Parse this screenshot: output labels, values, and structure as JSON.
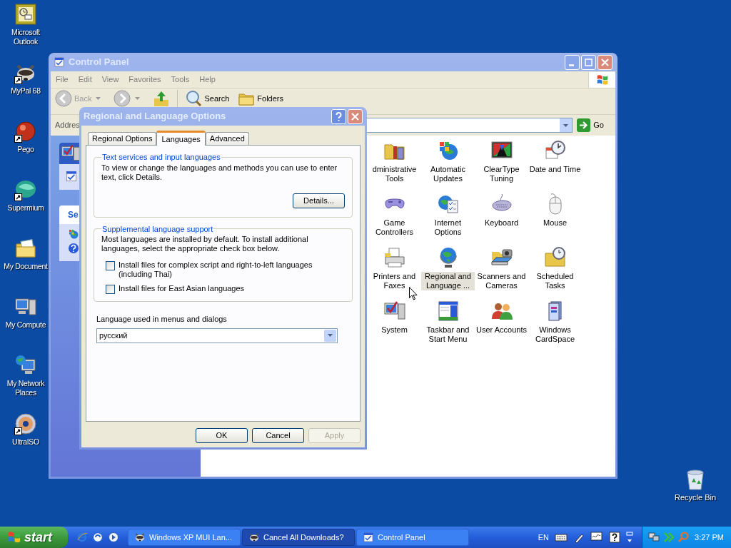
{
  "desktop": {
    "icons": [
      {
        "label": "Microsoft Outlook",
        "kind": "outlook",
        "shortcut": false
      },
      {
        "label": "MyPal 68",
        "kind": "raccoon",
        "shortcut": true
      },
      {
        "label": "Pego",
        "kind": "ball",
        "shortcut": true
      },
      {
        "label": "Supermium",
        "kind": "orb",
        "shortcut": true
      },
      {
        "label": "My Document",
        "kind": "documents",
        "shortcut": false
      },
      {
        "label": "My Compute",
        "kind": "computer",
        "shortcut": false
      },
      {
        "label": "My Network Places",
        "kind": "network",
        "shortcut": false
      },
      {
        "label": "UltraISO",
        "kind": "disc",
        "shortcut": true
      }
    ],
    "recycle_bin": {
      "label": "Recycle Bin"
    }
  },
  "control_panel": {
    "title": "Control Panel",
    "menu": [
      "File",
      "Edit",
      "View",
      "Favorites",
      "Tools",
      "Help"
    ],
    "toolbar": {
      "back": "Back",
      "search": "Search",
      "folders": "Folders"
    },
    "address": {
      "label": "Addres",
      "go": "Go"
    },
    "task_pane": {
      "section_title": "Se"
    },
    "items": [
      {
        "label": "dministrative Tools",
        "kind": "admin",
        "selected": false
      },
      {
        "label": "Automatic Updates",
        "kind": "updates",
        "selected": false
      },
      {
        "label": "ClearType Tuning",
        "kind": "cleartype",
        "selected": false
      },
      {
        "label": "Date and Time",
        "kind": "clock",
        "selected": false
      },
      {
        "label": "Game Controllers",
        "kind": "gamepad",
        "selected": false
      },
      {
        "label": "Internet Options",
        "kind": "internet",
        "selected": false
      },
      {
        "label": "Keyboard",
        "kind": "keyboard",
        "selected": false
      },
      {
        "label": "Mouse",
        "kind": "mouse",
        "selected": false
      },
      {
        "label": "Printers and Faxes",
        "kind": "printer",
        "selected": false
      },
      {
        "label": "Regional and Language ...",
        "kind": "globe",
        "selected": true
      },
      {
        "label": "Scanners and Cameras",
        "kind": "scanner",
        "selected": false
      },
      {
        "label": "Scheduled Tasks",
        "kind": "scheduled",
        "selected": false
      },
      {
        "label": "System",
        "kind": "system",
        "selected": false
      },
      {
        "label": "Taskbar and Start Menu",
        "kind": "taskbar",
        "selected": false
      },
      {
        "label": "User Accounts",
        "kind": "users",
        "selected": false
      },
      {
        "label": "Windows CardSpace",
        "kind": "cardspace",
        "selected": false
      }
    ]
  },
  "dialog": {
    "title": "Regional and Language Options",
    "tabs": [
      {
        "label": "Regional Options",
        "selected": false
      },
      {
        "label": "Languages",
        "selected": true
      },
      {
        "label": "Advanced",
        "selected": false
      }
    ],
    "text_services": {
      "legend": "Text services and input languages",
      "description": "To view or change the languages and methods you can use to enter text, click Details.",
      "button": "Details..."
    },
    "supplemental": {
      "legend": "Supplemental language support",
      "description": "Most languages are installed by default. To install additional languages, select the appropriate check box below.",
      "options": [
        {
          "label": "Install files for complex script and right-to-left languages (including Thai)",
          "checked": false
        },
        {
          "label": "Install files for East Asian languages",
          "checked": false
        }
      ]
    },
    "ui_language": {
      "label": "Language used in menus and dialogs",
      "value": "русский"
    },
    "buttons": [
      {
        "label": "OK",
        "disabled": false
      },
      {
        "label": "Cancel",
        "disabled": false
      },
      {
        "label": "Apply",
        "disabled": true
      }
    ]
  },
  "taskbar": {
    "start": "start",
    "quick_launch": [
      {
        "kind": "ie"
      },
      {
        "kind": "app"
      },
      {
        "kind": "media"
      }
    ],
    "tasks": [
      {
        "label": "Windows XP MUI Lan...",
        "kind": "raccoon",
        "selected": false
      },
      {
        "label": "Cancel All Downloads?",
        "kind": "raccoon",
        "selected": true
      },
      {
        "label": "Control Panel",
        "kind": "controlpanel",
        "selected": false
      }
    ],
    "language": "EN",
    "clock": "3:27 PM"
  }
}
